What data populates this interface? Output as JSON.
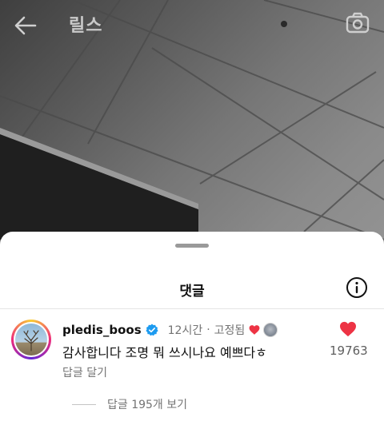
{
  "header": {
    "title": "릴스",
    "back_icon": "arrow-left-icon",
    "camera_icon": "camera-icon"
  },
  "sheet": {
    "title": "댓글",
    "info_icon": "info-icon"
  },
  "comment": {
    "username": "pledis_boos",
    "verified": true,
    "time": "12시간",
    "separator": "·",
    "pinned_label": "고정됨",
    "creator_liked": true,
    "text": "감사합니다 조명 뭐 쓰시나요 예쁘다ㅎ",
    "reply_label": "답글 달기",
    "like_count": "19763",
    "view_replies_label": "답글 195개 보기"
  },
  "colors": {
    "heart": "#ed3344",
    "verified": "#1d9bf0",
    "secondary_text": "#737373"
  }
}
